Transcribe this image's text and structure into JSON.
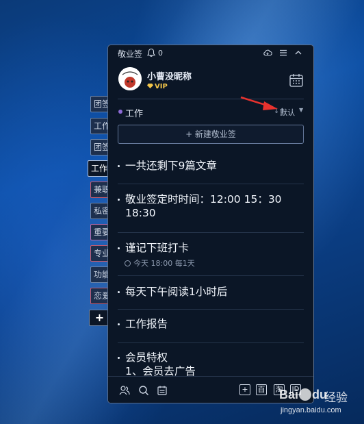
{
  "app": {
    "title": "敬业签",
    "notification_count": "0"
  },
  "profile": {
    "username": "小曹没昵称",
    "badge": "VIP"
  },
  "category": {
    "name": "工作",
    "sort_label": "默认",
    "sort_icon": "↓↑"
  },
  "new_note_button": "+ 新建敬业签",
  "side_tabs": [
    "团签",
    "工作",
    "团签",
    "工作",
    "兼职",
    "私密",
    "重要",
    "专业",
    "功能",
    "恋爱",
    "+"
  ],
  "notes": [
    {
      "text": "一共还剩下9篇文章"
    },
    {
      "text": "敬业签定时时间：12:00 15：30 18:30"
    },
    {
      "text": "谨记下班打卡",
      "reminder": "今天 18:00 每1天"
    },
    {
      "text": "每天下午阅读1小时后"
    },
    {
      "text": "工作报告"
    },
    {
      "text": "会员特权",
      "extra": "1、会员去广告"
    }
  ],
  "bottom_bar": {
    "add": "+",
    "baidu": "百",
    "taobao": "淘",
    "jd": "JD"
  },
  "watermark": {
    "brand": "Bai",
    "brand_tail": "du",
    "cn": "经验",
    "url": "jingyan.baidu.com"
  },
  "colors": {
    "panel_bg": "#0b1626",
    "accent_vip": "#f3c64a",
    "category_dot": "#8d6bd6",
    "arrow": "#e8322e"
  }
}
